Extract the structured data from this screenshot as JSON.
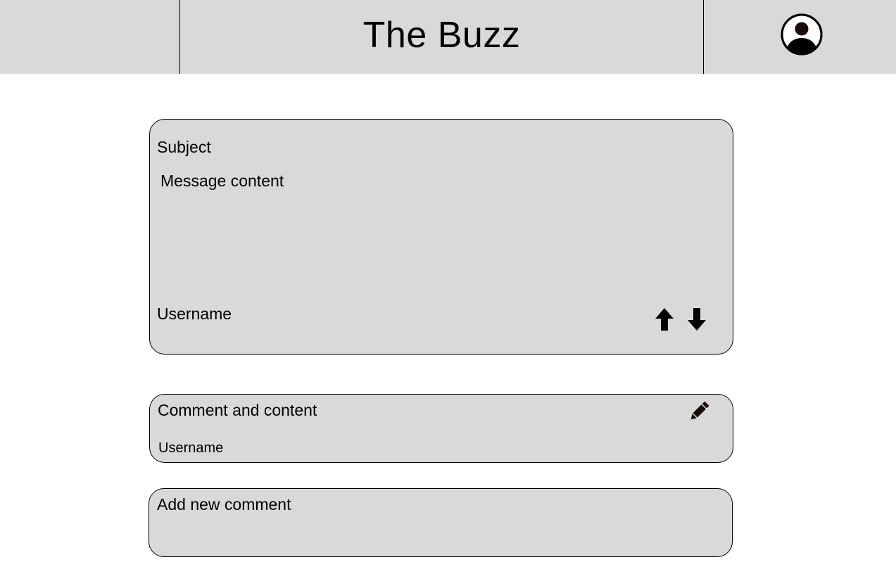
{
  "header": {
    "title": "The Buzz",
    "profile_icon": "user-circle-icon"
  },
  "message": {
    "subject": "Subject",
    "content": "Message content",
    "username": "Username",
    "upvote_icon": "arrow-up-icon",
    "downvote_icon": "arrow-down-icon"
  },
  "comment": {
    "content": "Comment and content",
    "username": "Username",
    "edit_icon": "pencil-icon"
  },
  "new_comment": {
    "placeholder": "Add new comment"
  },
  "colors": {
    "panel": "#d9d9d9",
    "background": "#ffffff",
    "border": "#000000",
    "icon": "#000000",
    "pencil": "#1a0a0a"
  }
}
